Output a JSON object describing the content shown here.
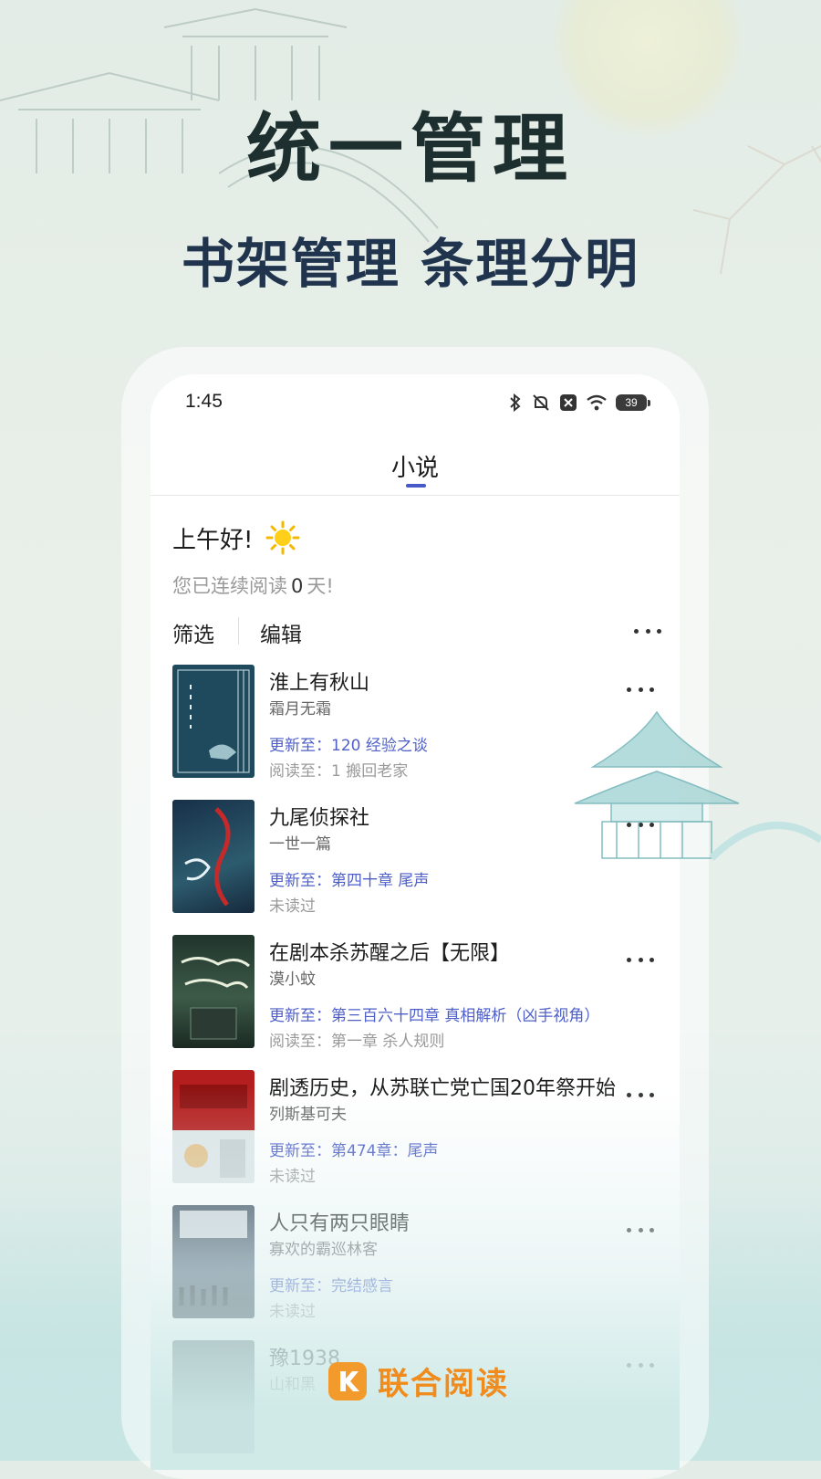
{
  "promo": {
    "headline": "统一管理",
    "subheadline": "书架管理 条理分明"
  },
  "status_bar": {
    "time": "1:45",
    "battery": "39",
    "icons": [
      "bluetooth-icon",
      "mute-icon",
      "notification-x-icon",
      "wifi-icon",
      "battery-icon"
    ]
  },
  "tabs": {
    "active": "小说"
  },
  "greeting": {
    "text": "上午好!",
    "icon": "sun-icon",
    "streak_prefix": "您已连续阅读",
    "streak_days": "0",
    "streak_suffix": "天!"
  },
  "toolbar": {
    "filter_label": "筛选",
    "edit_label": "编辑"
  },
  "books": [
    {
      "title": "淮上有秋山",
      "author": "霜月无霜",
      "update": "更新至：120 经验之谈",
      "progress": "阅读至：1 搬回老家"
    },
    {
      "title": "九尾侦探社",
      "author": "一世一篇",
      "update": "更新至：第四十章 尾声",
      "progress": "未读过"
    },
    {
      "title": "在剧本杀苏醒之后【无限】",
      "author": "漠小蚊",
      "update": "更新至：第三百六十四章 真相解析（凶手视角）",
      "progress": "阅读至：第一章  杀人规则"
    },
    {
      "title": "剧透历史，从苏联亡党亡国20年祭开始",
      "author": "列斯基可夫",
      "update": "更新至：第474章：尾声",
      "progress": "未读过"
    },
    {
      "title": "人只有两只眼睛",
      "author": "寡欢的霸巡林客",
      "update": "更新至：完结感言",
      "progress": "未读过"
    },
    {
      "title": "豫1938",
      "author": "山和黑",
      "update": "",
      "progress": ""
    }
  ],
  "brand": {
    "name": "联合阅读"
  },
  "colors": {
    "accent": "#4758c8",
    "brand": "#f08c1e",
    "update_text": "#4e5fc9"
  }
}
